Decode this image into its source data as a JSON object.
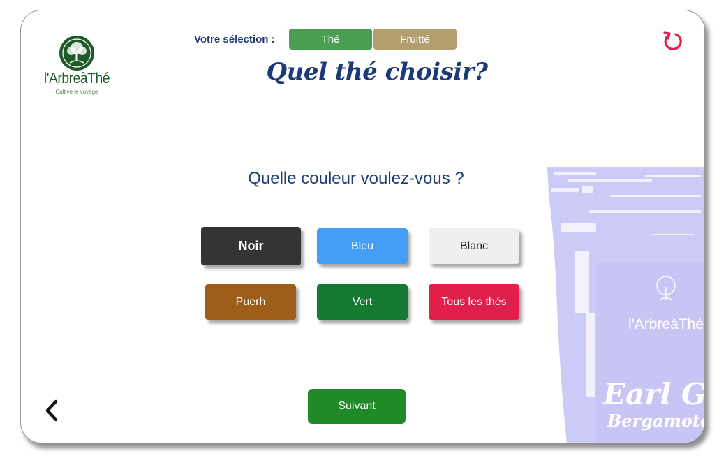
{
  "brand": {
    "name": "l'ArbreàThé",
    "tagline": "Cultive le voyage",
    "color": "#1f5a2a"
  },
  "selection": {
    "label": "Votre sélection :",
    "chips": [
      "Thé",
      "Fruitté"
    ]
  },
  "title": "Quel thé choisir?",
  "question": "Quelle couleur voulez-vous ?",
  "options": [
    "Noir",
    "Bleu",
    "Blanc",
    "Puerh",
    "Vert",
    "Tous les thés"
  ],
  "next_label": "Suivant",
  "icons": {
    "reset": "refresh-icon",
    "back": "chevron-left-icon"
  },
  "bag": {
    "brand": "l'ArbreàThé",
    "product": "Earl Gre",
    "subtitle": "Bergamote"
  },
  "colors": {
    "title": "#1c3a78",
    "accent_reset": "#e0204a",
    "next": "#208a28"
  }
}
